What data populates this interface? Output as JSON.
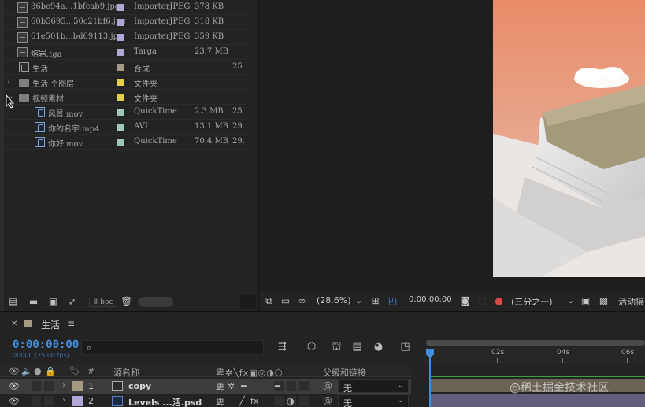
{
  "project": {
    "files": [
      {
        "name": "36be94a...1bfcab9.jpg",
        "type": "ImporterJPEG",
        "size": "378 KB",
        "fps": "",
        "swatch": "#b2a6d6",
        "icon": "image-file-icon",
        "indent": 1
      },
      {
        "name": "60b5695...50c21bf6.jpg",
        "type": "ImporterJPEG",
        "size": "318 KB",
        "fps": "",
        "swatch": "#b2a6d6",
        "icon": "image-file-icon",
        "indent": 1
      },
      {
        "name": "61e501b...bd69113.jpg",
        "type": "ImporterJPEG",
        "size": "359 KB",
        "fps": "",
        "swatch": "#b2a6d6",
        "icon": "image-file-icon",
        "indent": 1
      },
      {
        "name": "熔岩.tga",
        "type": "Targa",
        "size": "23.7 MB",
        "fps": "",
        "swatch": "#b2a6d6",
        "icon": "image-file-icon",
        "indent": 1
      },
      {
        "name": "生活",
        "type": "合成",
        "size": "",
        "fps": "25",
        "swatch": "#a69a84",
        "icon": "composition-icon",
        "indent": 0
      },
      {
        "name": "生活 个图层",
        "type": "文件夹",
        "size": "",
        "fps": "",
        "swatch": "#e2cf4a",
        "icon": "folder-icon",
        "indent": 0,
        "chevron": "›"
      },
      {
        "name": "视频素材",
        "type": "文件夹",
        "size": "",
        "fps": "",
        "swatch": "#e2cf4a",
        "icon": "folder-icon",
        "indent": 0,
        "chevron": "⌄"
      },
      {
        "name": "风景.mov",
        "type": "QuickTime",
        "size": "2.3 MB",
        "fps": "25",
        "swatch": "#9ec9b5",
        "icon": "video-file-icon",
        "indent": 2
      },
      {
        "name": "你的名字.mp4",
        "type": "AVI",
        "size": "13.1 MB",
        "fps": "29.",
        "swatch": "#9ec9b5",
        "icon": "video-file-icon",
        "indent": 2
      },
      {
        "name": "你好.mov",
        "type": "QuickTime",
        "size": "70.4 MB",
        "fps": "29.",
        "swatch": "#9ec9b5",
        "icon": "video-file-icon",
        "indent": 2
      }
    ],
    "footer": {
      "bpc": "8 bpc"
    }
  },
  "viewer": {
    "zoom": "(28.6%)",
    "timecode": "0:00:00:00",
    "resolution": "(三分之一)",
    "active_camera": "活动摄"
  },
  "timeline": {
    "comp_name": "生活",
    "timecode": "0:00:00:00",
    "subcode": "00000 (25.00 fps)",
    "columns": {
      "num": "#",
      "source_name": "源名称",
      "parent": "父级和链接"
    },
    "ruler_ticks": [
      "0s",
      "02s",
      "04s",
      "06s"
    ],
    "layers": [
      {
        "num": "1",
        "name": "copy",
        "swatch": "#a69a84",
        "icon": "composition-icon",
        "parent": "无",
        "track_color": "#6b6455",
        "selected": true
      },
      {
        "num": "2",
        "name": "Levels ...活.psd",
        "swatch": "#b2a6d6",
        "icon": "photoshop-file-icon",
        "parent": "无",
        "track_color": "#645e7c",
        "selected": false
      }
    ]
  },
  "watermark": "@稀土掘金技术社区",
  "colors": {
    "accent": "#3f8ee0",
    "panel": "#232323",
    "canvas_orange": "#e8906c"
  }
}
